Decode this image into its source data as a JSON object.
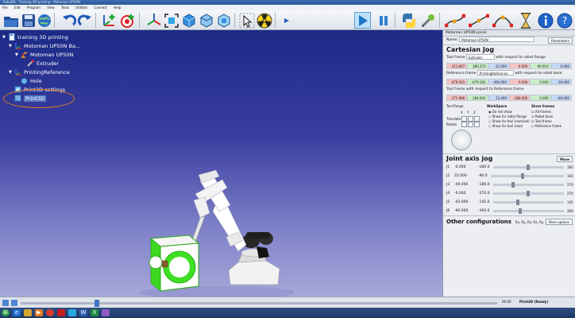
{
  "window": {
    "title": "RoboDK - Training 3D printing - Motoman UP50N"
  },
  "menu": {
    "items": [
      "File",
      "Edit",
      "Program",
      "View",
      "Tools",
      "Utilities",
      "Connect",
      "Help"
    ]
  },
  "toolbar": {
    "icons": [
      "open-folder-icon",
      "save-icon",
      "globe-icon",
      "undo-icon",
      "redo-icon",
      "add-reference-frame-icon",
      "add-target-icon",
      "reference-frame-icon",
      "fit-view-icon",
      "iso-view-icon",
      "cube-view-icon",
      "collision-icon",
      "cursor-icon",
      "radiation-icon",
      "play-icon",
      "pause-icon",
      "python-icon",
      "tool-icon",
      "joint-move-icon",
      "linear-move-icon",
      "circular-move-icon",
      "pause-instruction-icon",
      "info-icon",
      "help-icon"
    ]
  },
  "tree": {
    "items": [
      {
        "label": "training 3D printing",
        "level": 0,
        "icon": "station-icon",
        "expander": "▼"
      },
      {
        "label": "Motoman UP50N Ba...",
        "level": 1,
        "icon": "reference-frame-icon",
        "expander": "▼"
      },
      {
        "label": "Motoman UP50N",
        "level": 2,
        "icon": "robot-icon",
        "expander": "▼"
      },
      {
        "label": "Extruder",
        "level": 3,
        "icon": "tool-icon",
        "expander": ""
      },
      {
        "label": "PrintingReference",
        "level": 1,
        "icon": "reference-frame-icon",
        "expander": "▼"
      },
      {
        "label": "Hole",
        "level": 2,
        "icon": "object-icon",
        "expander": ""
      },
      {
        "label": "Print3D settings",
        "level": 1,
        "icon": "settings-icon",
        "expander": ""
      },
      {
        "label": "Print3D",
        "level": 1,
        "icon": "program-icon",
        "expander": "",
        "selected": true
      }
    ]
  },
  "panel": {
    "header": "Motoman UP50N panel",
    "name_label": "Name:",
    "name_value": "Motoman UP50N",
    "param_button": "Parameters",
    "cartesian_title": "Cartesian Jog",
    "tool_frame_label": "Tool frame",
    "tool_frame_value": "Extruder",
    "tool_frame_note": "with respect to robot flange",
    "tool_values": [
      "311.667",
      "280.373",
      "-12.000",
      "0.000",
      "90.910",
      "0.000"
    ],
    "ref_frame_label": "Reference frame",
    "ref_frame_value": "PrintingReference",
    "ref_frame_note": "with respect to robot base",
    "ref_values": [
      "679.931",
      "-679.161",
      "-400.000",
      "0.000",
      "0.000",
      "-30.000"
    ],
    "tool_ref_label": "Tool frame with respect to Reference frame",
    "tool_ref_values": [
      "271.966",
      "284.602",
      "13.499",
      "-180.000",
      "0.000",
      "-60.000"
    ],
    "jog_labels": [
      "Tool flange",
      "X",
      "Y",
      "Z",
      "Translate",
      "Rotate"
    ],
    "workspace_title": "WorkSpace",
    "workspace_options": [
      "Do not show",
      "Show for robot flange",
      "Show for tool (nominal)",
      "Show for tool (real)"
    ],
    "display_title": "Show frames",
    "display_options": [
      "All frames",
      "Robot base",
      "Tool frame",
      "Reference frame"
    ],
    "joint_title": "Joint axis jog",
    "joint_max_btn": "Move",
    "joints": [
      {
        "name": "J1",
        "min": "-180.0",
        "value": "-0.000",
        "max": "180",
        "pos": 0.5
      },
      {
        "name": "J2",
        "min": "-90.0",
        "value": "22.000",
        "max": "160",
        "pos": 0.44
      },
      {
        "name": "J3",
        "min": "-180.0",
        "value": "-49.000",
        "max": "270",
        "pos": 0.29
      },
      {
        "name": "J4",
        "min": "-270.0",
        "value": "-0.000",
        "max": "270",
        "pos": 0.5
      },
      {
        "name": "J5",
        "min": "-145.0",
        "value": "-42.000",
        "max": "145",
        "pos": 0.35
      },
      {
        "name": "J6",
        "min": "-360.0",
        "value": "-90.000",
        "max": "360",
        "pos": 0.38
      }
    ],
    "other_config_title": "Other configurations",
    "other_config_value": "Rx, Ry, Rz, Rx, Ry, Rz",
    "more_options": "More options"
  },
  "timeline": {
    "label": "Print3D (Ready)",
    "time": "00:00",
    "progress": 0.16
  },
  "taskbar": {
    "icons": [
      "start-icon",
      "ie-icon",
      "folder-icon",
      "media-icon",
      "chrome-icon",
      "pdf-icon",
      "robodk-icon",
      "word-icon",
      "excel-icon",
      "paint-icon"
    ]
  },
  "colors": {
    "viewport_top": "#1c2a86",
    "viewport_bottom": "#a8a8d9",
    "selection_ring": "#e67b22",
    "cube_green": "#34d41a",
    "x_cell": "#f7c3c3",
    "y_cell": "#c8f0c8",
    "z_cell": "#c6d8f7"
  }
}
